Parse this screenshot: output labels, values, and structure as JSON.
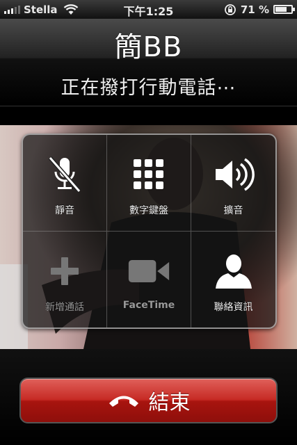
{
  "status_bar": {
    "carrier": "Stella",
    "time": "下午1:25",
    "battery_percent": "71 %",
    "battery_level": 0.71,
    "signal_bars": 3,
    "icons": [
      "signal-icon",
      "wifi-icon",
      "rotation-lock-icon",
      "battery-icon"
    ]
  },
  "call": {
    "name": "簡BB",
    "status": "正在撥打行動電話⋯"
  },
  "buttons": [
    {
      "label": "靜音",
      "icon": "mute-microphone-icon",
      "enabled": true
    },
    {
      "label": "數字鍵盤",
      "icon": "keypad-icon",
      "enabled": true
    },
    {
      "label": "擴音",
      "icon": "speaker-icon",
      "enabled": true
    },
    {
      "label": "新增通話",
      "icon": "add-call-icon",
      "enabled": false
    },
    {
      "label": "FaceTime",
      "icon": "facetime-camera-icon",
      "enabled": false
    },
    {
      "label": "聯絡資訊",
      "icon": "contact-person-icon",
      "enabled": true
    }
  ],
  "end_call": {
    "label": "結束",
    "icon": "hang-up-phone-icon",
    "color": "#c62a24"
  }
}
